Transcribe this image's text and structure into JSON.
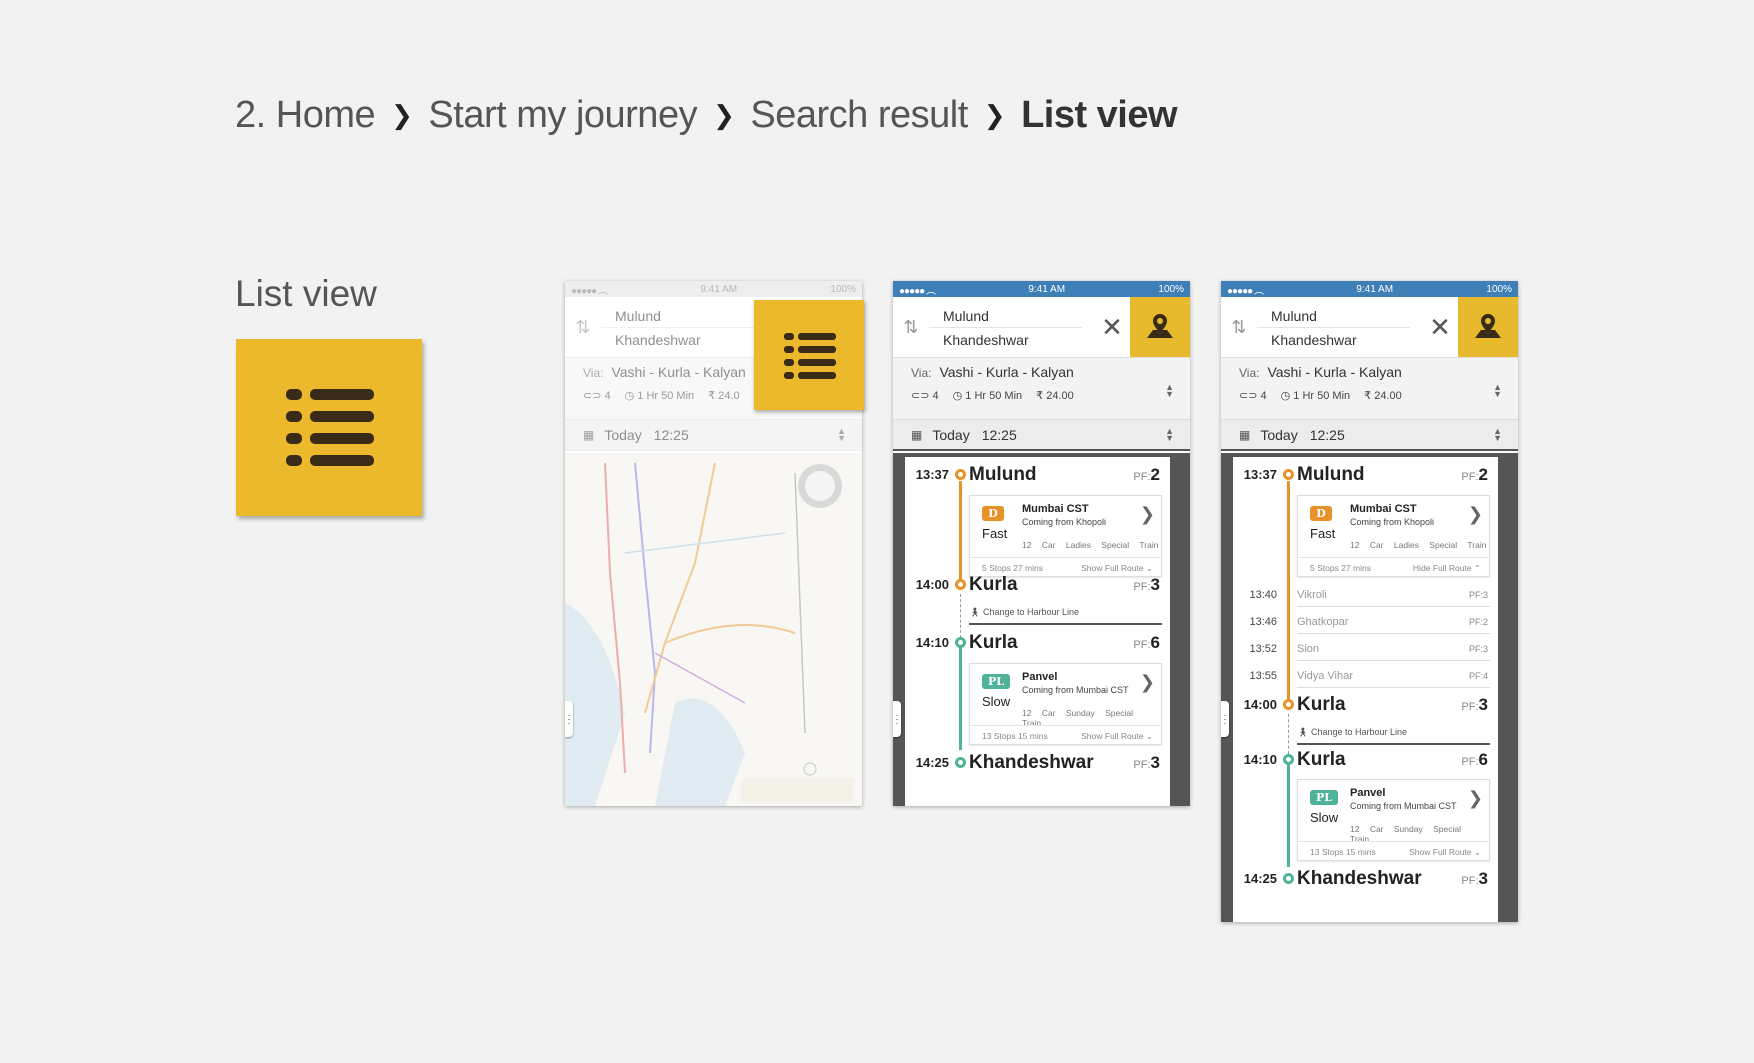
{
  "breadcrumb": {
    "step": "2. Home",
    "items": [
      "Start my journey",
      "Search result",
      "List view"
    ]
  },
  "section_label": "List view",
  "status": {
    "time": "9:41 AM",
    "battery": "100%"
  },
  "search": {
    "from": "Mulund",
    "to": "Khandeshwar",
    "via_label": "Via:",
    "via": "Vashi - Kurla - Kalyan",
    "changes": "4",
    "duration": "1 Hr 50 Min",
    "fare": "₹ 24.00",
    "fare_short": "₹ 24.0"
  },
  "date": {
    "day": "Today",
    "time": "12:25"
  },
  "journey": {
    "leg1": {
      "time": "13:37",
      "station": "Mulund",
      "pf_label": "PF:",
      "pf": "2",
      "badge": "D",
      "speed": "Fast",
      "dest": "Mumbai CST",
      "from": "Coming from Khopoli",
      "cars": "12 Car",
      "note": "Ladies Special Train",
      "stops": "5 Stops",
      "mins": "27 mins",
      "show_route": "Show Full Route",
      "hide_route": "Hide Full Route"
    },
    "kurla_arr": {
      "time": "14:00",
      "station": "Kurla",
      "pf": "3"
    },
    "change": "Change to Harbour Line",
    "leg2": {
      "time": "14:10",
      "station": "Kurla",
      "pf": "6",
      "badge": "PL",
      "speed": "Slow",
      "dest": "Panvel",
      "from": "Coming from Mumbai CST",
      "cars": "12 Car",
      "note": "Sunday Special Train",
      "stops": "13 Stops",
      "mins": "15 mins",
      "show_route": "Show Full Route"
    },
    "end": {
      "time": "14:25",
      "station": "Khandeshwar",
      "pf": "3"
    },
    "intermediate": [
      {
        "time": "13:40",
        "station": "Vikroli",
        "pf": "PF:3"
      },
      {
        "time": "13:46",
        "station": "Ghatkopar",
        "pf": "PF:2"
      },
      {
        "time": "13:52",
        "station": "Sion",
        "pf": "PF:3"
      },
      {
        "time": "13:55",
        "station": "Vidya Vihar",
        "pf": "PF:4"
      }
    ]
  },
  "icons": {
    "list": "list-icon",
    "map": "map-pin-icon",
    "swap": "swap-icon",
    "close": "close-icon"
  },
  "colors": {
    "accent": "#ecb82c",
    "fast_line": "#e8932a",
    "slow_line": "#4fb39a",
    "status_bar": "#3e7fb8"
  }
}
